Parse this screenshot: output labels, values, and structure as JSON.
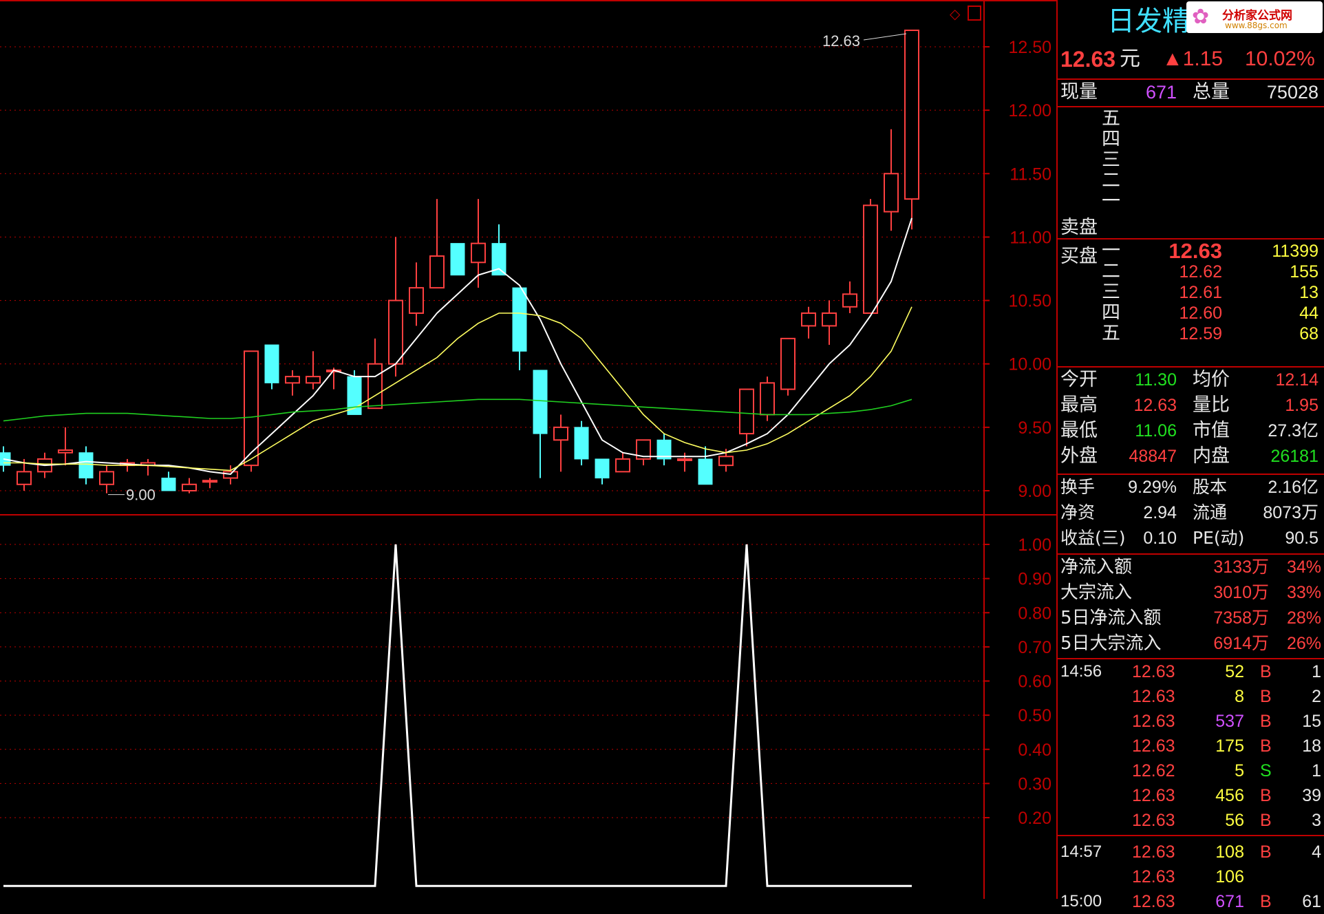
{
  "stock_title": "日发精",
  "watermark": {
    "text": "分析家公式网",
    "url": "www.88gs.com"
  },
  "corner_icons": [
    "diamond-icon",
    "window-icon"
  ],
  "quote": {
    "price": "12.63",
    "unit": "元",
    "change": "▲1.15",
    "change_pct": "10.02%"
  },
  "volume": {
    "now_label": "现量",
    "now": "671",
    "total_label": "总量",
    "total": "75028"
  },
  "sell_label": "卖盘",
  "sell_levels": [
    "五",
    "四",
    "三",
    "二",
    "一"
  ],
  "buy_label": "买盘",
  "buy_levels": [
    {
      "level": "一",
      "price": "12.63",
      "vol": "11399"
    },
    {
      "level": "二",
      "price": "12.62",
      "vol": "155"
    },
    {
      "level": "三",
      "price": "12.61",
      "vol": "13"
    },
    {
      "level": "四",
      "price": "12.60",
      "vol": "44"
    },
    {
      "level": "五",
      "price": "12.59",
      "vol": "68"
    }
  ],
  "stats": [
    {
      "l1": "今开",
      "v1": "11.30",
      "c1": "g",
      "l2": "均价",
      "v2": "12.14",
      "c2": "r"
    },
    {
      "l1": "最高",
      "v1": "12.63",
      "c1": "r",
      "l2": "量比",
      "v2": "1.95",
      "c2": "r"
    },
    {
      "l1": "最低",
      "v1": "11.06",
      "c1": "g",
      "l2": "市值",
      "v2": "27.3亿",
      "c2": "w"
    },
    {
      "l1": "外盘",
      "v1": "48847",
      "c1": "r",
      "l2": "内盘",
      "v2": "26181",
      "c2": "g"
    }
  ],
  "fundamentals": [
    {
      "l1": "换手",
      "v1": "9.29%",
      "l2": "股本",
      "v2": "2.16亿"
    },
    {
      "l1": "净资",
      "v1": "2.94",
      "l2": "流通",
      "v2": "8073万"
    },
    {
      "l1": "收益(三)",
      "v1": "0.10",
      "l2": "PE(动)",
      "v2": "90.5"
    }
  ],
  "flows": [
    {
      "label": "净流入额",
      "value": "3133万",
      "pct": "34%"
    },
    {
      "label": "大宗流入",
      "value": "3010万",
      "pct": "33%"
    },
    {
      "label": "5日净流入额",
      "value": "7358万",
      "pct": "28%"
    },
    {
      "label": "5日大宗流入",
      "value": "6914万",
      "pct": "26%"
    }
  ],
  "ticks": [
    {
      "time": "14:56",
      "price": "12.63",
      "vol": "52",
      "bs": "B",
      "n": "1"
    },
    {
      "time": "",
      "price": "12.63",
      "vol": "8",
      "bs": "B",
      "n": "2"
    },
    {
      "time": "",
      "price": "12.63",
      "vol": "537",
      "bs": "B",
      "n": "15"
    },
    {
      "time": "",
      "price": "12.63",
      "vol": "175",
      "bs": "B",
      "n": "18"
    },
    {
      "time": "",
      "price": "12.62",
      "vol": "5",
      "bs": "S",
      "n": "1"
    },
    {
      "time": "",
      "price": "12.63",
      "vol": "456",
      "bs": "B",
      "n": "39"
    },
    {
      "time": "",
      "price": "12.63",
      "vol": "56",
      "bs": "B",
      "n": "3"
    },
    {
      "time": "14:57",
      "price": "12.63",
      "vol": "108",
      "bs": "B",
      "n": "4"
    },
    {
      "time": "",
      "price": "12.63",
      "vol": "106",
      "bs": "",
      "n": ""
    },
    {
      "time": "15:00",
      "price": "12.63",
      "vol": "671",
      "bs": "B",
      "n": "61"
    }
  ],
  "colors": {
    "up": "#ff4040",
    "down": "#54ffff",
    "ma5": "#ffffff",
    "ma10": "#ffff60",
    "ma60": "#20d020",
    "grid": "#c00000"
  },
  "chart_data": [
    {
      "type": "candlestick",
      "ylim": [
        8.85,
        12.63
      ],
      "y_ticks": [
        "12.50",
        "12.00",
        "11.50",
        "11.00",
        "10.50",
        "10.00",
        "9.50",
        "9.00"
      ],
      "annotations": [
        {
          "text": "12.63",
          "at": "high"
        },
        {
          "text": "9.00",
          "at": "low"
        }
      ],
      "candles": [
        [
          9.3,
          9.2,
          9.35,
          9.15
        ],
        [
          9.05,
          9.15,
          9.25,
          9.0
        ],
        [
          9.15,
          9.25,
          9.3,
          9.1
        ],
        [
          9.3,
          9.32,
          9.5,
          9.2
        ],
        [
          9.3,
          9.1,
          9.35,
          9.05
        ],
        [
          9.05,
          9.15,
          9.2,
          8.98
        ],
        [
          9.2,
          9.22,
          9.25,
          9.15
        ],
        [
          9.2,
          9.22,
          9.25,
          9.12
        ],
        [
          9.1,
          9.0,
          9.15,
          9.0
        ],
        [
          9.0,
          9.05,
          9.1,
          8.98
        ],
        [
          9.08,
          9.08,
          9.1,
          9.02
        ],
        [
          9.1,
          9.15,
          9.2,
          9.05
        ],
        [
          9.2,
          10.1,
          10.1,
          9.15
        ],
        [
          10.15,
          9.85,
          10.15,
          9.8
        ],
        [
          9.85,
          9.9,
          9.95,
          9.75
        ],
        [
          9.85,
          9.9,
          10.1,
          9.8
        ],
        [
          9.95,
          9.95,
          9.97,
          9.8
        ],
        [
          9.9,
          9.6,
          9.95,
          9.6
        ],
        [
          9.65,
          10.0,
          10.2,
          9.65
        ],
        [
          10.0,
          10.5,
          11.0,
          9.9
        ],
        [
          10.4,
          10.6,
          10.8,
          10.3
        ],
        [
          10.6,
          10.85,
          11.3,
          10.6
        ],
        [
          10.95,
          10.7,
          10.95,
          10.7
        ],
        [
          10.8,
          10.95,
          11.3,
          10.6
        ],
        [
          10.95,
          10.7,
          11.1,
          10.7
        ],
        [
          10.6,
          10.1,
          10.6,
          9.95
        ],
        [
          9.95,
          9.45,
          9.95,
          9.1
        ],
        [
          9.4,
          9.5,
          9.6,
          9.15
        ],
        [
          9.5,
          9.25,
          9.55,
          9.2
        ],
        [
          9.25,
          9.1,
          9.25,
          9.05
        ],
        [
          9.15,
          9.25,
          9.3,
          9.15
        ],
        [
          9.25,
          9.4,
          9.4,
          9.2
        ],
        [
          9.4,
          9.25,
          9.45,
          9.2
        ],
        [
          9.25,
          9.25,
          9.3,
          9.15
        ],
        [
          9.25,
          9.05,
          9.35,
          9.05
        ],
        [
          9.2,
          9.27,
          9.33,
          9.15
        ],
        [
          9.45,
          9.8,
          9.8,
          9.35
        ],
        [
          9.6,
          9.85,
          9.9,
          9.55
        ],
        [
          9.8,
          10.2,
          10.2,
          9.75
        ],
        [
          10.3,
          10.4,
          10.45,
          10.2
        ],
        [
          10.3,
          10.4,
          10.5,
          10.15
        ],
        [
          10.45,
          10.55,
          10.65,
          10.4
        ],
        [
          10.4,
          11.25,
          11.3,
          10.4
        ],
        [
          11.2,
          11.5,
          11.85,
          11.05
        ],
        [
          11.3,
          12.63,
          12.63,
          11.06
        ]
      ],
      "series": [
        {
          "name": "MA5",
          "values": [
            9.25,
            9.22,
            9.2,
            9.21,
            9.23,
            9.22,
            9.21,
            9.2,
            9.2,
            9.18,
            9.15,
            9.13,
            9.3,
            9.45,
            9.6,
            9.75,
            9.95,
            9.9,
            9.9,
            10.0,
            10.2,
            10.4,
            10.55,
            10.7,
            10.75,
            10.62,
            10.35,
            10.0,
            9.7,
            9.4,
            9.3,
            9.27,
            9.27,
            9.27,
            9.27,
            9.3,
            9.37,
            9.45,
            9.6,
            9.8,
            10.0,
            10.15,
            10.38,
            10.65,
            11.15
          ]
        },
        {
          "name": "MA10",
          "values": [
            9.22,
            9.22,
            9.21,
            9.21,
            9.21,
            9.2,
            9.2,
            9.2,
            9.19,
            9.18,
            9.17,
            9.16,
            9.25,
            9.35,
            9.45,
            9.55,
            9.6,
            9.65,
            9.75,
            9.85,
            9.95,
            10.05,
            10.2,
            10.32,
            10.4,
            10.4,
            10.38,
            10.32,
            10.2,
            10.0,
            9.8,
            9.6,
            9.45,
            9.38,
            9.33,
            9.3,
            9.32,
            9.37,
            9.45,
            9.55,
            9.65,
            9.75,
            9.9,
            10.1,
            10.45
          ]
        },
        {
          "name": "MA60",
          "values": [
            9.55,
            9.57,
            9.59,
            9.6,
            9.61,
            9.61,
            9.61,
            9.6,
            9.59,
            9.58,
            9.57,
            9.57,
            9.58,
            9.6,
            9.62,
            9.63,
            9.64,
            9.66,
            9.67,
            9.68,
            9.69,
            9.7,
            9.71,
            9.72,
            9.72,
            9.72,
            9.71,
            9.7,
            9.69,
            9.68,
            9.67,
            9.66,
            9.65,
            9.64,
            9.63,
            9.62,
            9.61,
            9.6,
            9.6,
            9.6,
            9.61,
            9.62,
            9.64,
            9.67,
            9.72
          ]
        }
      ]
    },
    {
      "type": "line",
      "ylim": [
        0,
        1.05
      ],
      "y_ticks": [
        "1.00",
        "0.90",
        "0.80",
        "0.70",
        "0.60",
        "0.50",
        "0.40",
        "0.30",
        "0.20"
      ],
      "values": [
        0,
        0,
        0,
        0,
        0,
        0,
        0,
        0,
        0,
        0,
        0,
        0,
        0,
        0,
        0,
        0,
        0,
        0,
        0,
        1,
        0,
        0,
        0,
        0,
        0,
        0,
        0,
        0,
        0,
        0,
        0,
        0,
        0,
        0,
        0,
        0,
        1,
        0,
        0,
        0,
        0,
        0,
        0,
        0,
        0
      ]
    }
  ]
}
